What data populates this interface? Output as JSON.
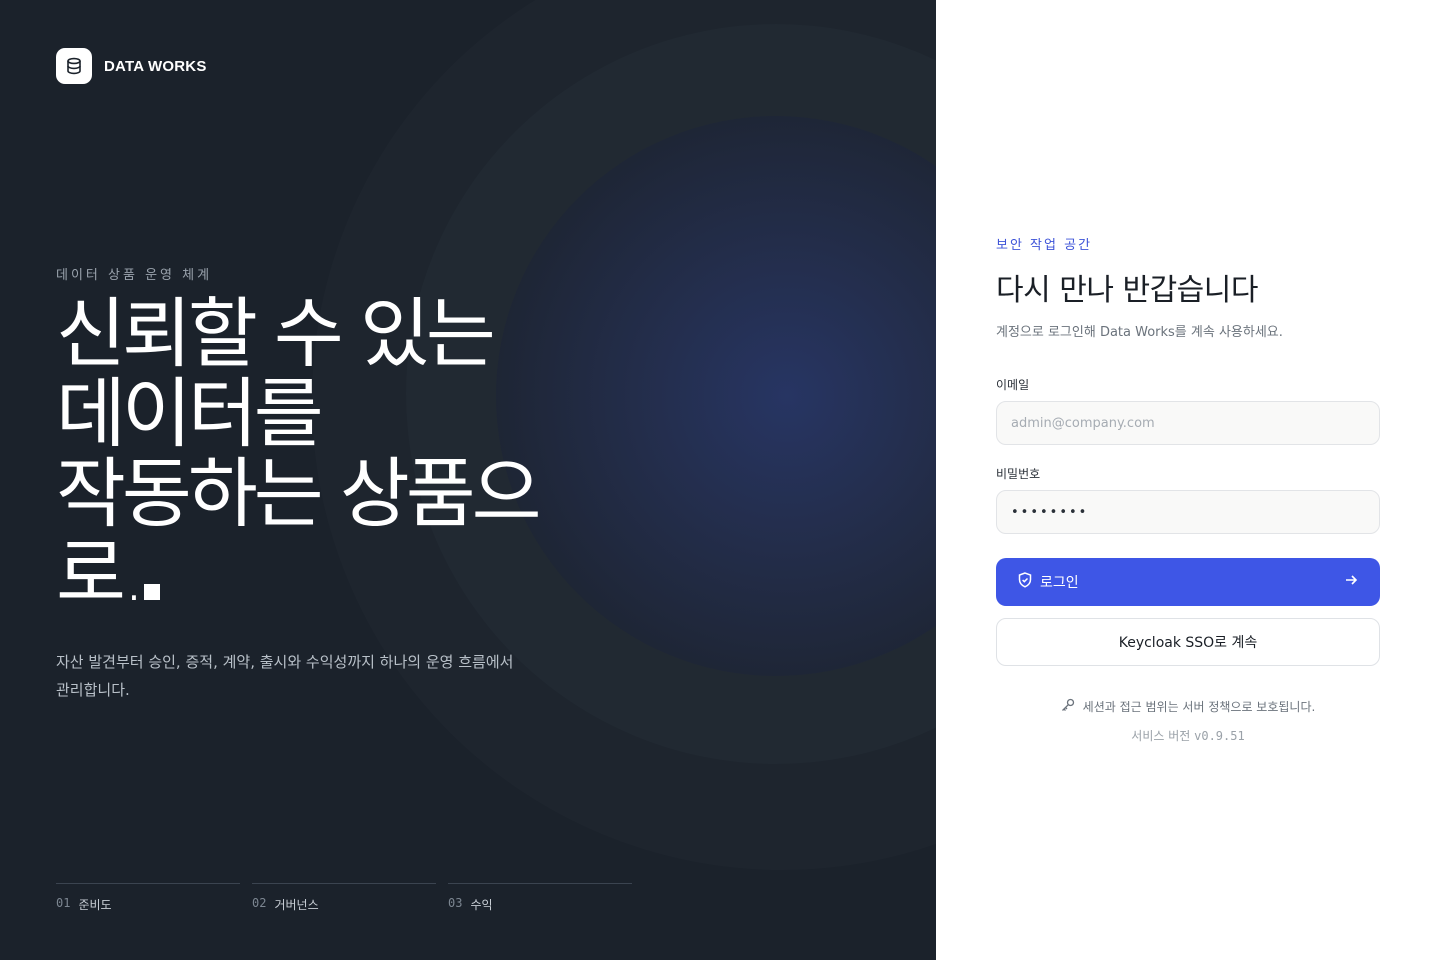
{
  "brand": {
    "name": "DATA WORKS",
    "logo_icon": "database-icon"
  },
  "hero": {
    "eyebrow": "데이터 상품 운영 체계",
    "headline_lines": [
      "신뢰할 수 있는",
      "데이터를",
      "작동하는 상품으",
      "로."
    ],
    "description_lines": [
      "자산 발견부터 승인, 증적, 계약, 출시와 수익성까지 하나의 운영 흐름에서",
      "관리합니다."
    ]
  },
  "steps": [
    {
      "num": "01",
      "label": "준비도"
    },
    {
      "num": "02",
      "label": "거버넌스"
    },
    {
      "num": "03",
      "label": "수익"
    }
  ],
  "login": {
    "kicker": "보안 작업 공간",
    "title": "다시 만나 반갑습니다",
    "subtitle": "계정으로 로그인해 Data Works를 계속 사용하세요.",
    "email_label": "이메일",
    "email_placeholder": "admin@company.com",
    "password_label": "비밀번호",
    "password_value": "••••••••",
    "login_button": "로그인",
    "sso_button": "Keycloak SSO로 계속",
    "security_note": "세션과 접근 범위는 서버 정책으로 보호됩니다.",
    "version_label": "서비스 버전",
    "version": "v0.9.51"
  },
  "colors": {
    "dark_bg": "#1b222b",
    "accent": "#3e56e6",
    "kicker": "#3d53d8"
  }
}
